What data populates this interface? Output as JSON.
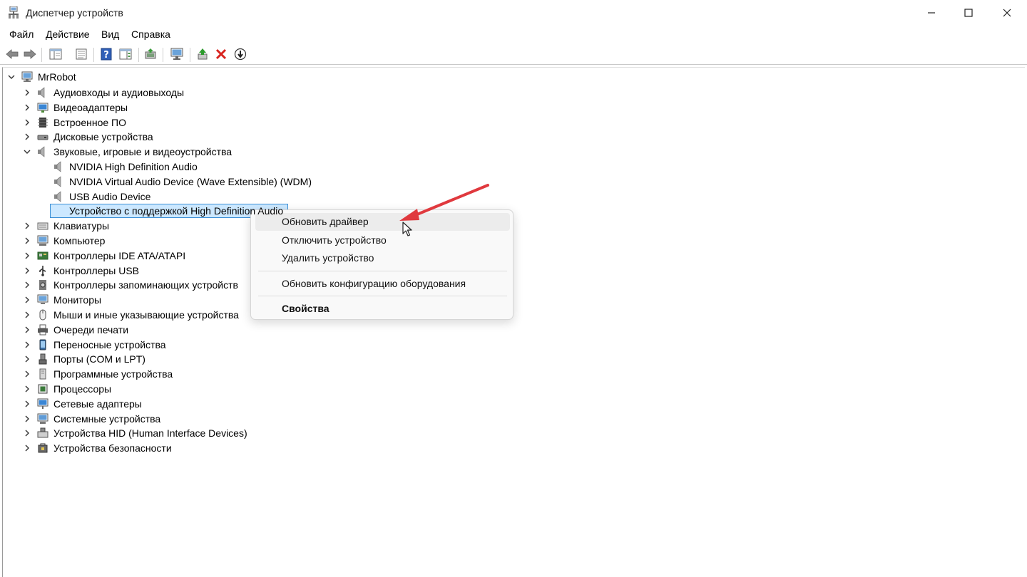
{
  "window": {
    "title": "Диспетчер устройств",
    "controls": [
      "minimize",
      "maximize",
      "close"
    ]
  },
  "menu": {
    "file": "Файл",
    "action": "Действие",
    "view": "Вид",
    "help": "Справка"
  },
  "toolbar": {
    "icons": [
      "back-arrow-icon",
      "forward-arrow-icon",
      "show-hide-console-tree-icon",
      "properties-sheet-icon",
      "help-icon",
      "action-pane-icon",
      "update-driver-icon",
      "scan-hardware-icon",
      "enable-device-icon",
      "uninstall-device-icon",
      "download-icon"
    ]
  },
  "tree": {
    "root": "MrRobot",
    "categories": [
      {
        "label": "Аудиовходы и аудиовыходы",
        "icon": "speaker-icon"
      },
      {
        "label": "Видеоадаптеры",
        "icon": "display-adapter-icon"
      },
      {
        "label": "Встроенное ПО",
        "icon": "firmware-icon"
      },
      {
        "label": "Дисковые устройства",
        "icon": "disk-drive-icon"
      },
      {
        "label": "Звуковые, игровые и видеоустройства",
        "icon": "speaker-icon",
        "expanded": true
      },
      {
        "label": "Клавиатуры",
        "icon": "keyboard-icon"
      },
      {
        "label": "Компьютер",
        "icon": "computer-icon"
      },
      {
        "label": "Контроллеры IDE ATA/ATAPI",
        "icon": "ide-controller-icon"
      },
      {
        "label": "Контроллеры USB",
        "icon": "usb-icon"
      },
      {
        "label": "Контроллеры запоминающих устройств",
        "icon": "storage-controller-icon"
      },
      {
        "label": "Мониторы",
        "icon": "monitor-icon"
      },
      {
        "label": "Мыши и иные указывающие устройства",
        "icon": "mouse-icon"
      },
      {
        "label": "Очереди печати",
        "icon": "printer-icon"
      },
      {
        "label": "Переносные устройства",
        "icon": "portable-device-icon"
      },
      {
        "label": "Порты (COM и LPT)",
        "icon": "port-icon"
      },
      {
        "label": "Программные устройства",
        "icon": "software-device-icon"
      },
      {
        "label": "Процессоры",
        "icon": "processor-icon"
      },
      {
        "label": "Сетевые адаптеры",
        "icon": "network-adapter-icon"
      },
      {
        "label": "Системные устройства",
        "icon": "system-device-icon"
      },
      {
        "label": "Устройства HID (Human Interface Devices)",
        "icon": "hid-icon"
      },
      {
        "label": "Устройства безопасности",
        "icon": "security-device-icon"
      }
    ],
    "sound_children": [
      {
        "label": "NVIDIA High Definition Audio"
      },
      {
        "label": "NVIDIA Virtual Audio Device (Wave Extensible) (WDM)"
      },
      {
        "label": "USB Audio Device"
      },
      {
        "label": "Устройство с поддержкой High Definition Audio",
        "selected": true
      }
    ]
  },
  "context_menu": {
    "update_driver": "Обновить драйвер",
    "disable_device": "Отключить устройство",
    "uninstall_device": "Удалить устройство",
    "scan_hardware": "Обновить конфигурацию оборудования",
    "properties": "Свойства"
  },
  "colors": {
    "selection_fill": "#cce8ff",
    "selection_border": "#3b8fd6",
    "annotation_arrow": "#e0393e"
  }
}
